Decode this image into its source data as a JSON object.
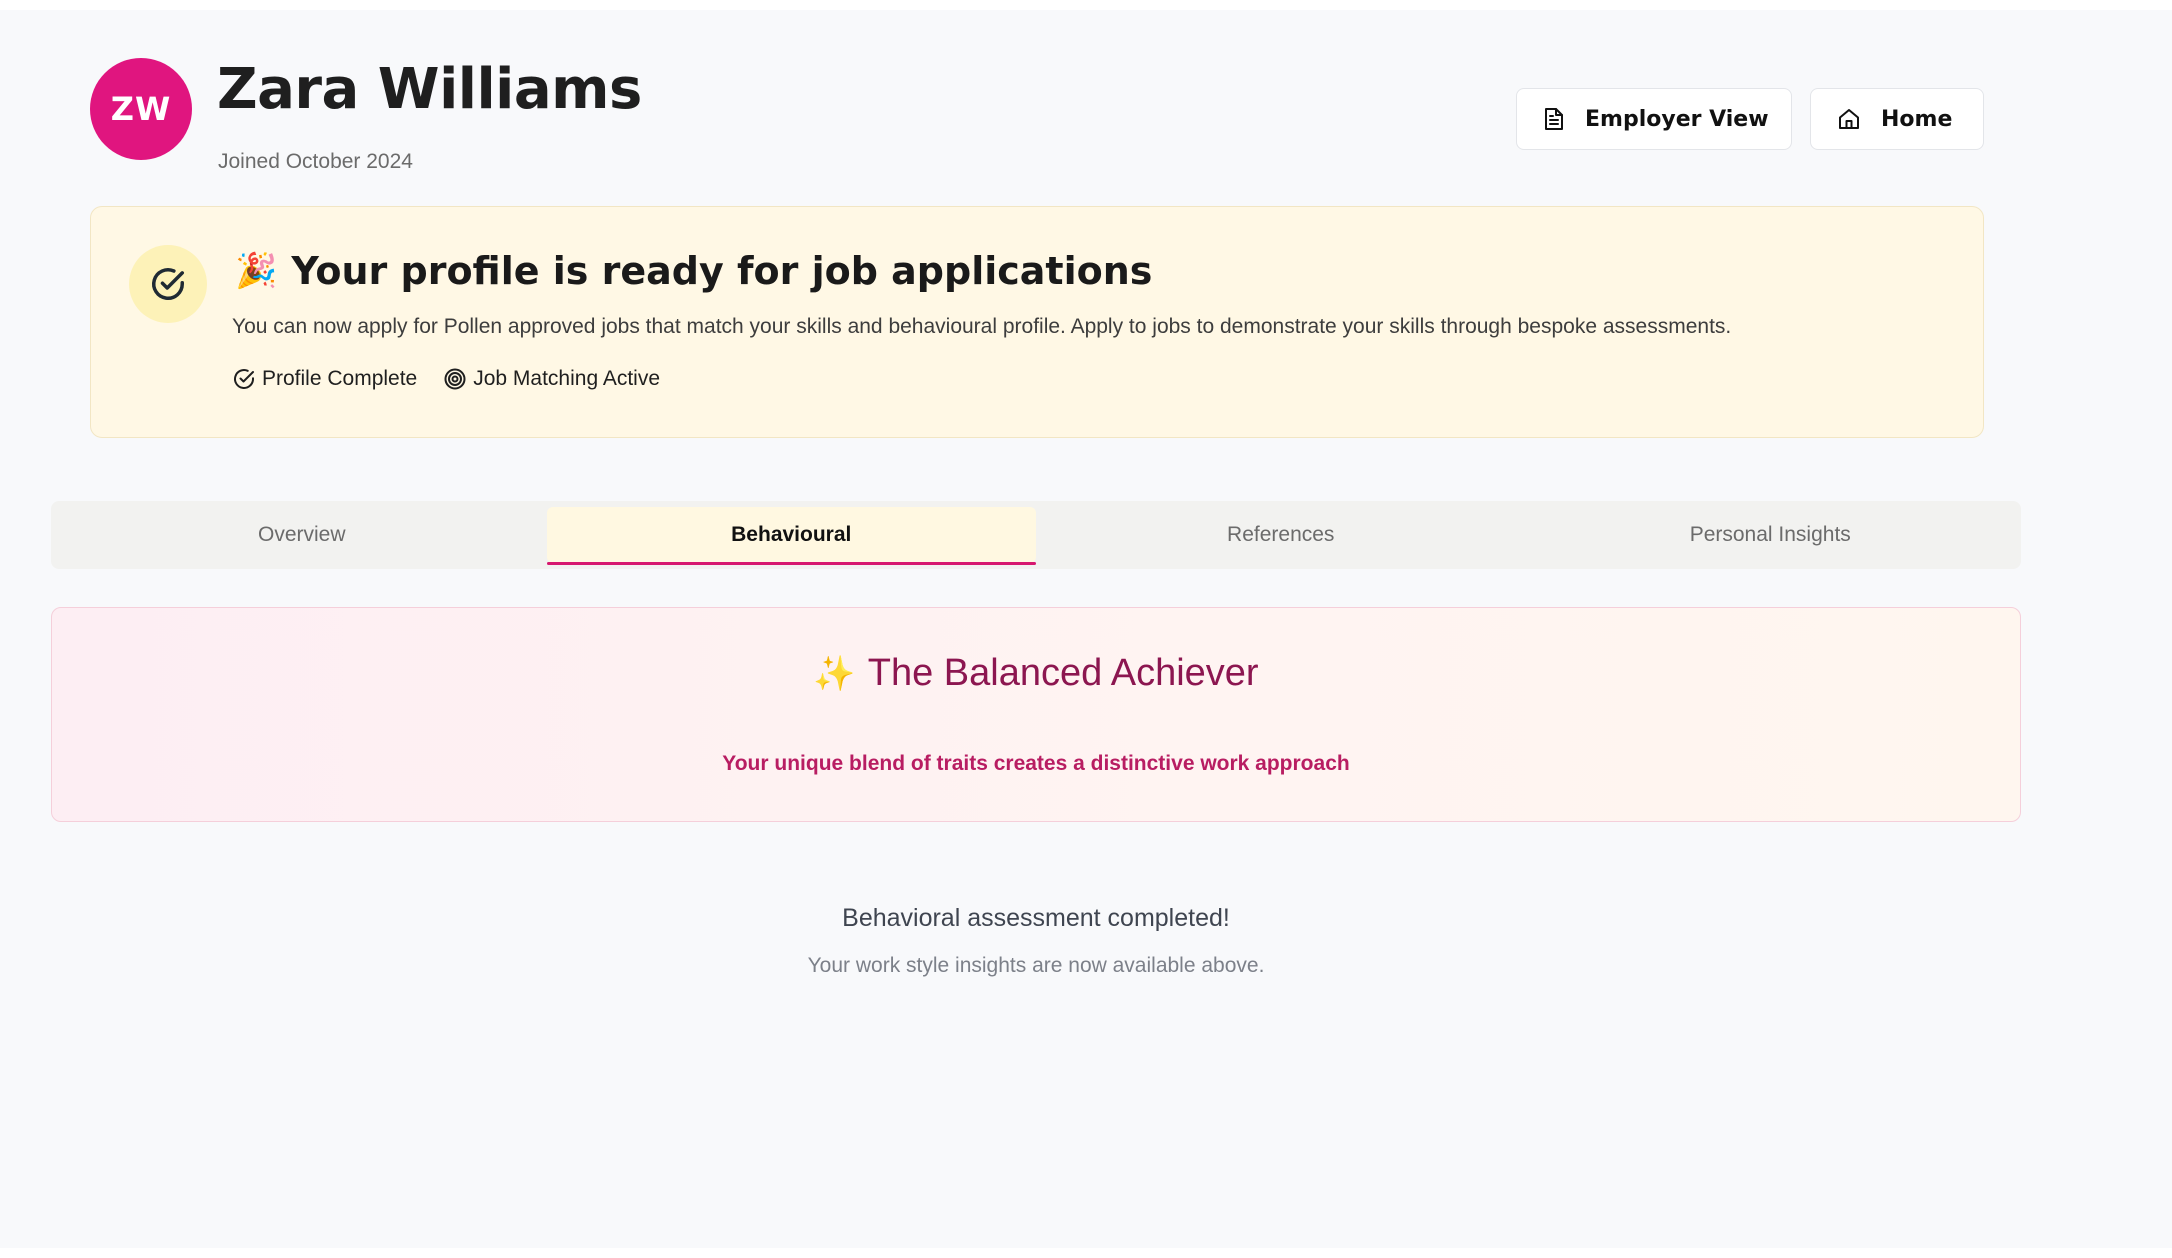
{
  "profile": {
    "initials": "ZW",
    "name": "Zara Williams",
    "joined": "Joined October 2024"
  },
  "header_actions": {
    "employer_view": "Employer View",
    "home": "Home"
  },
  "banner": {
    "emoji": "🎉",
    "title": "Your profile is ready for job applications",
    "description": "You can now apply for Pollen approved jobs that match your skills and behavioural profile. Apply to jobs to demonstrate your skills through bespoke assessments.",
    "badges": {
      "profile_complete": "Profile Complete",
      "job_matching": "Job Matching Active"
    }
  },
  "tabs": [
    "Overview",
    "Behavioural",
    "References",
    "Personal Insights"
  ],
  "active_tab": "Behavioural",
  "persona": {
    "emoji": "✨",
    "title": "The Balanced Achiever",
    "subtitle": "Your unique blend of traits creates a distinctive work approach"
  },
  "assessment": {
    "title": "Behavioral assessment completed!",
    "subtitle": "Your work style insights are now available above."
  },
  "colors": {
    "accent": "#e0157f",
    "banner_bg": "#fff8e5",
    "persona_title": "#8c1650",
    "persona_subtitle": "#b81d62"
  },
  "icons": {
    "employer_view": "document-icon",
    "home": "home-icon",
    "banner": "check-circle-icon",
    "profile_complete": "check-circle-icon",
    "job_matching": "target-icon"
  }
}
